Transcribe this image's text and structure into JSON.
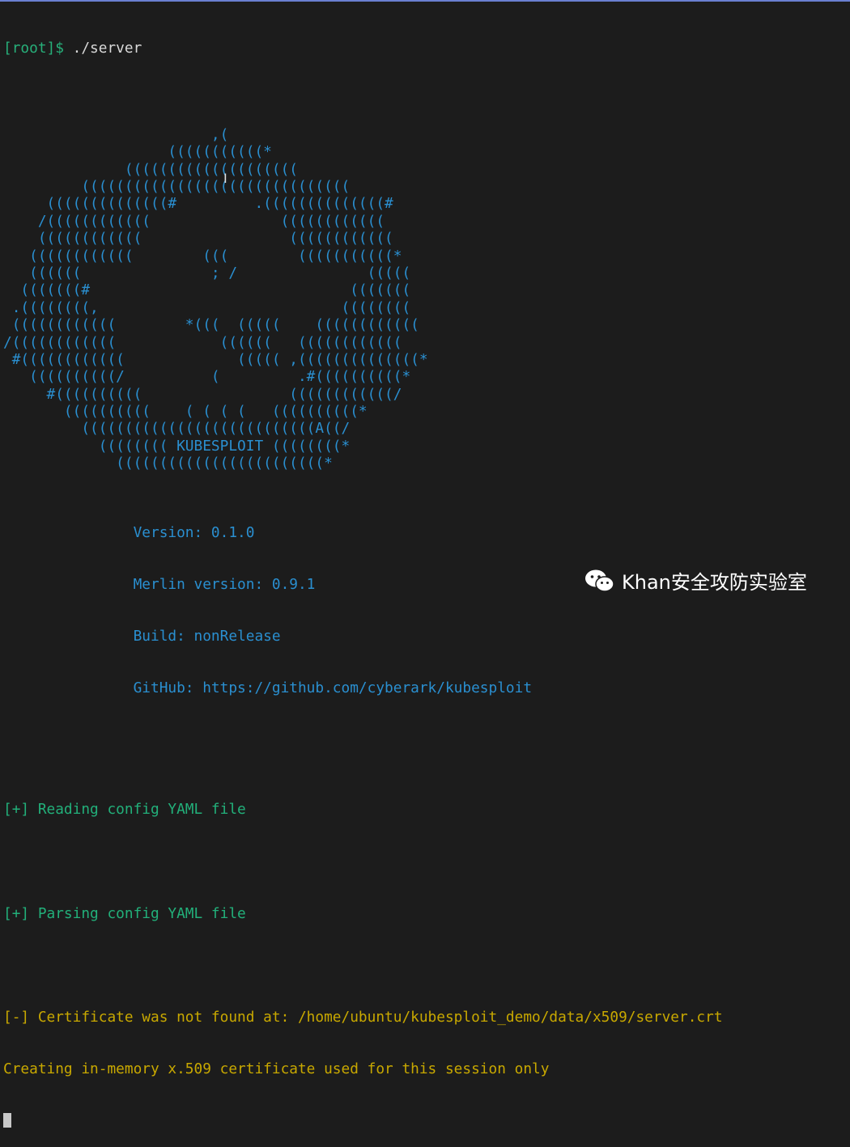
{
  "terminal": {
    "prompt_user": "[root]$",
    "command": " ./server",
    "ascii_art": [
      "",
      "                        ,(",
      "                   (((((((((((*",
      "              ((((((((((((((((((((",
      "         (((((((((((((((((((((((((((((((",
      "     ((((((((((((((#         .((((((((((((((#",
      "    /((((((((((((               ((((((((((((",
      "    ((((((((((((                 ((((((((((((",
      "   ((((((((((((        (((        (((((((((((*",
      "   ((((((               ; /               (((((",
      "  (((((((#                              (((((((",
      " .((((((((,                            ((((((((",
      " ((((((((((((        *(((  (((((    ((((((((((((",
      "/((((((((((((            ((((((   ((((((((((((",
      " #((((((((((((             ((((( ,((((((((((((((*",
      "   ((((((((((/          (         .#((((((((((*",
      "     #((((((((((                 ((((((((((((/",
      "       ((((((((((    ( ( ( (   ((((((((((*",
      "         (((((((((((((((((((((((((((A((/",
      "           (((((((( KUBESPLOIT ((((((((*",
      "             ((((((((((((((((((((((((*"
    ],
    "info_lines": [
      "               Version: 0.1.0",
      "               Merlin version: 0.9.1",
      "               Build: nonRelease",
      "               GitHub: https://github.com/cyberark/kubesploit"
    ],
    "messages": {
      "reading": "[+] Reading config YAML file",
      "parsing": "[+] Parsing config YAML file",
      "cert_not_found": "[-] Certificate was not found at: /home/ubuntu/kubesploit_demo/data/x509/server.crt",
      "creating": "Creating in-memory x.509 certificate used for this session only"
    }
  },
  "watermark": {
    "icon": "wechat-icon",
    "text": "Khan安全攻防实验室"
  },
  "colors": {
    "background": "#1c1c1c",
    "prompt": "#27b07a",
    "art": "#2a8fd0",
    "ok": "#22b07a",
    "warn": "#c8a800"
  }
}
